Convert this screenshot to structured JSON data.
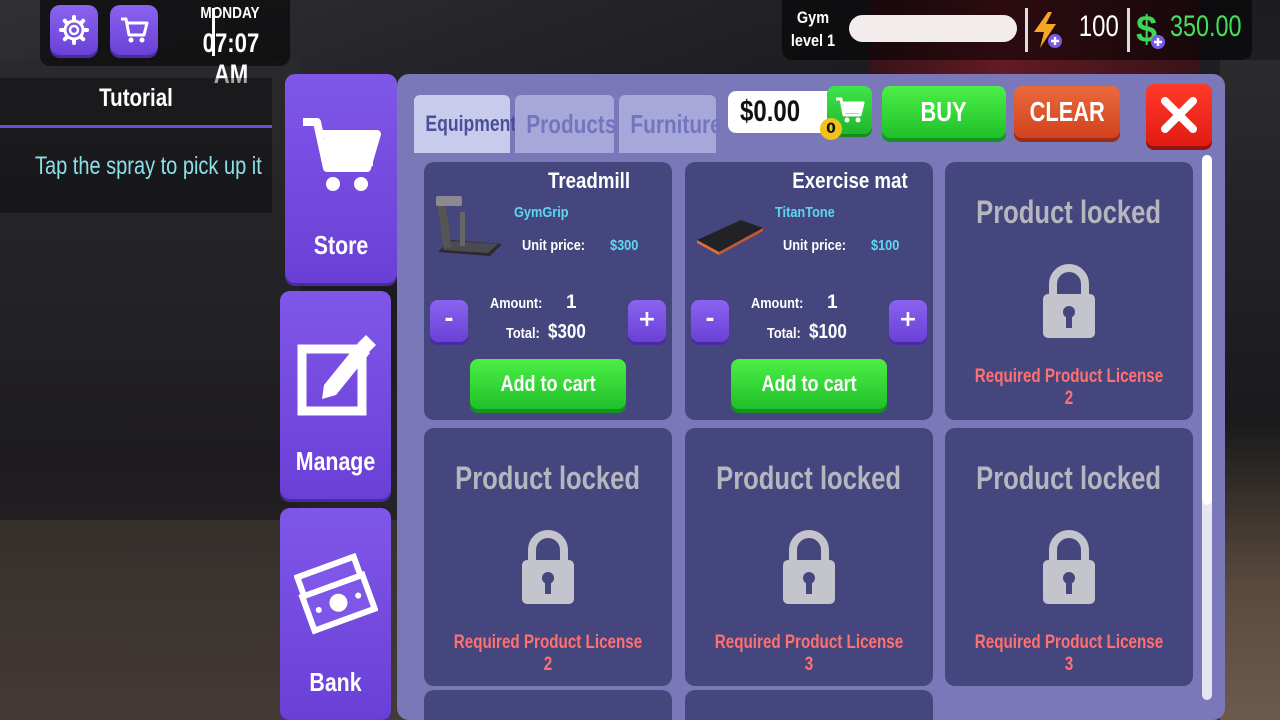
{
  "hud": {
    "day": "MONDAY",
    "time": "07:07 AM",
    "gym_level_line1": "Gym",
    "gym_level_line2": "level 1",
    "xp_progress": 0.0,
    "energy": "100",
    "money": "350.00"
  },
  "tutorial": {
    "title": "Tutorial",
    "text": "Tap the spray to pick up it"
  },
  "nav": {
    "store": "Store",
    "manage": "Manage",
    "bank": "Bank"
  },
  "store": {
    "tabs": [
      "Equipment",
      "Products",
      "Furniture"
    ],
    "active_tab": "Equipment",
    "cart_total": "$0.00",
    "cart_count": "0",
    "buy_label": "BUY",
    "clear_label": "CLEAR"
  },
  "products": [
    {
      "name": "Treadmill",
      "brand": "GymGrip",
      "unit_price_label": "Unit price:",
      "unit_price": "$300",
      "amount_label": "Amount:",
      "amount": "1",
      "total_label": "Total:",
      "total": "$300",
      "add_label": "Add to cart"
    },
    {
      "name": "Exercise mat",
      "brand": "TitanTone",
      "unit_price_label": "Unit price:",
      "unit_price": "$100",
      "amount_label": "Amount:",
      "amount": "1",
      "total_label": "Total:",
      "total": "$100",
      "add_label": "Add to cart"
    }
  ],
  "locked": [
    {
      "title": "Product locked",
      "requirement": "Required Product License 2"
    },
    {
      "title": "Product locked",
      "requirement": "Required Product License 2"
    },
    {
      "title": "Product locked",
      "requirement": "Required Product License 3"
    },
    {
      "title": "Product locked",
      "requirement": "Required Product License 3"
    }
  ],
  "colors": {
    "accent_purple": "#7f57e8",
    "panel": "#7b78b9",
    "card": "#46467e",
    "green": "#20c02a",
    "red": "#e11b12",
    "money_green": "#44e05a",
    "brand_cyan": "#5fd6f1",
    "locked_red": "#ff7070"
  }
}
